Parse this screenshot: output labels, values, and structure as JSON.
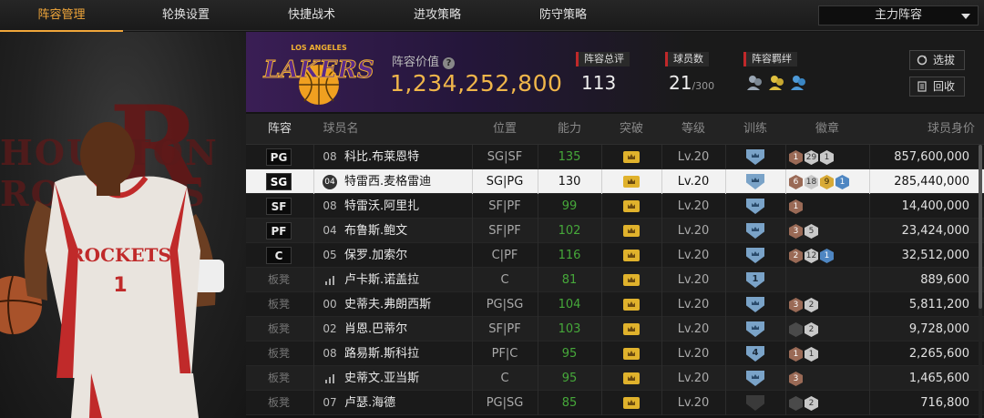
{
  "nav": {
    "tabs": [
      {
        "label": "阵容管理",
        "active": true
      },
      {
        "label": "轮换设置",
        "active": false
      },
      {
        "label": "快捷战术",
        "active": false
      },
      {
        "label": "进攻策略",
        "active": false
      },
      {
        "label": "防守策略",
        "active": false
      }
    ],
    "lineup_select": "主力阵容"
  },
  "player_panel": {
    "jersey_text": "ROCKETS",
    "jersey_number": "1",
    "background_text": "HOUSTON ROCKETS"
  },
  "team": {
    "logo_text": "LAKERS",
    "logo_subtext": "LOS ANGELES",
    "value_label": "阵容价值",
    "value": "1,234,252,800",
    "rating_label": "阵容总评",
    "rating": "113",
    "count_label": "球员数",
    "count": "21",
    "count_max": "/300",
    "bond_label": "阵容羁绊",
    "buttons": {
      "transfer": "选拔",
      "recycle": "回收"
    }
  },
  "table": {
    "headers": [
      "阵容",
      "球员名",
      "位置",
      "能力",
      "突破",
      "等级",
      "训练",
      "徽章",
      "球员身价"
    ],
    "rows": [
      {
        "slot": "PG",
        "starter": true,
        "number": "08",
        "num_style": "plain",
        "name": "科比.布莱恩特",
        "position": "SG|SF",
        "ability": "135",
        "level": "Lv.20",
        "training": "crown",
        "badges": [
          {
            "t": "bronze",
            "v": "1"
          },
          {
            "t": "silver",
            "v": "29"
          },
          {
            "t": "silver",
            "v": "1"
          }
        ],
        "value": "857,600,000"
      },
      {
        "slot": "SG",
        "starter": true,
        "number": "04",
        "num_style": "circle",
        "name": "特雷西.麦格雷迪",
        "position": "SG|PG",
        "ability": "130",
        "level": "Lv.20",
        "training": "crown",
        "badges": [
          {
            "t": "bronze",
            "v": "6"
          },
          {
            "t": "silver",
            "v": "18"
          },
          {
            "t": "gold",
            "v": "9"
          },
          {
            "t": "blue",
            "v": "1"
          }
        ],
        "value": "285,440,000",
        "selected": true
      },
      {
        "slot": "SF",
        "starter": true,
        "number": "08",
        "num_style": "plain",
        "name": "特雷沃.阿里扎",
        "position": "SF|PF",
        "ability": "99",
        "level": "Lv.20",
        "training": "crown",
        "badges": [
          {
            "t": "bronze",
            "v": "1"
          }
        ],
        "value": "14,400,000"
      },
      {
        "slot": "PF",
        "starter": true,
        "number": "04",
        "num_style": "plain",
        "name": "布鲁斯.鲍文",
        "position": "SF|PF",
        "ability": "102",
        "level": "Lv.20",
        "training": "crown",
        "badges": [
          {
            "t": "bronze",
            "v": "3"
          },
          {
            "t": "silver",
            "v": "5"
          }
        ],
        "value": "23,424,000"
      },
      {
        "slot": "C",
        "starter": true,
        "number": "05",
        "num_style": "plain",
        "name": "保罗.加索尔",
        "position": "C|PF",
        "ability": "116",
        "level": "Lv.20",
        "training": "crown",
        "badges": [
          {
            "t": "bronze",
            "v": "2"
          },
          {
            "t": "silver",
            "v": "12"
          },
          {
            "t": "blue",
            "v": "1"
          }
        ],
        "value": "32,512,000"
      },
      {
        "slot": "板凳",
        "starter": false,
        "number": "",
        "num_style": "bars",
        "name": "卢卡斯.诺盖拉",
        "position": "C",
        "ability": "81",
        "level": "Lv.20",
        "training": "1",
        "badges": [],
        "value": "889,600"
      },
      {
        "slot": "板凳",
        "starter": false,
        "number": "00",
        "num_style": "plain",
        "name": "史蒂夫.弗朗西斯",
        "position": "PG|SG",
        "ability": "104",
        "level": "Lv.20",
        "training": "crown",
        "badges": [
          {
            "t": "bronze",
            "v": "3"
          },
          {
            "t": "silver",
            "v": "2"
          }
        ],
        "value": "5,811,200"
      },
      {
        "slot": "板凳",
        "starter": false,
        "number": "02",
        "num_style": "plain",
        "name": "肖恩.巴蒂尔",
        "position": "SF|PF",
        "ability": "103",
        "level": "Lv.20",
        "training": "crown",
        "badges": [
          {
            "t": "darkb",
            "v": ""
          },
          {
            "t": "silver",
            "v": "2"
          }
        ],
        "value": "9,728,000"
      },
      {
        "slot": "板凳",
        "starter": false,
        "number": "08",
        "num_style": "plain",
        "name": "路易斯.斯科拉",
        "position": "PF|C",
        "ability": "95",
        "level": "Lv.20",
        "training": "4",
        "badges": [
          {
            "t": "bronze",
            "v": "1"
          },
          {
            "t": "silver",
            "v": "1"
          }
        ],
        "value": "2,265,600"
      },
      {
        "slot": "板凳",
        "starter": false,
        "number": "",
        "num_style": "bars",
        "name": "史蒂文.亚当斯",
        "position": "C",
        "ability": "95",
        "level": "Lv.20",
        "training": "crown",
        "badges": [
          {
            "t": "bronze",
            "v": "3"
          }
        ],
        "value": "1,465,600"
      },
      {
        "slot": "板凳",
        "starter": false,
        "number": "07",
        "num_style": "plain",
        "name": "卢瑟.海德",
        "position": "PG|SG",
        "ability": "85",
        "level": "Lv.20",
        "training": "dark",
        "badges": [
          {
            "t": "darkb",
            "v": ""
          },
          {
            "t": "silver",
            "v": "2"
          }
        ],
        "value": "716,800"
      }
    ]
  }
}
